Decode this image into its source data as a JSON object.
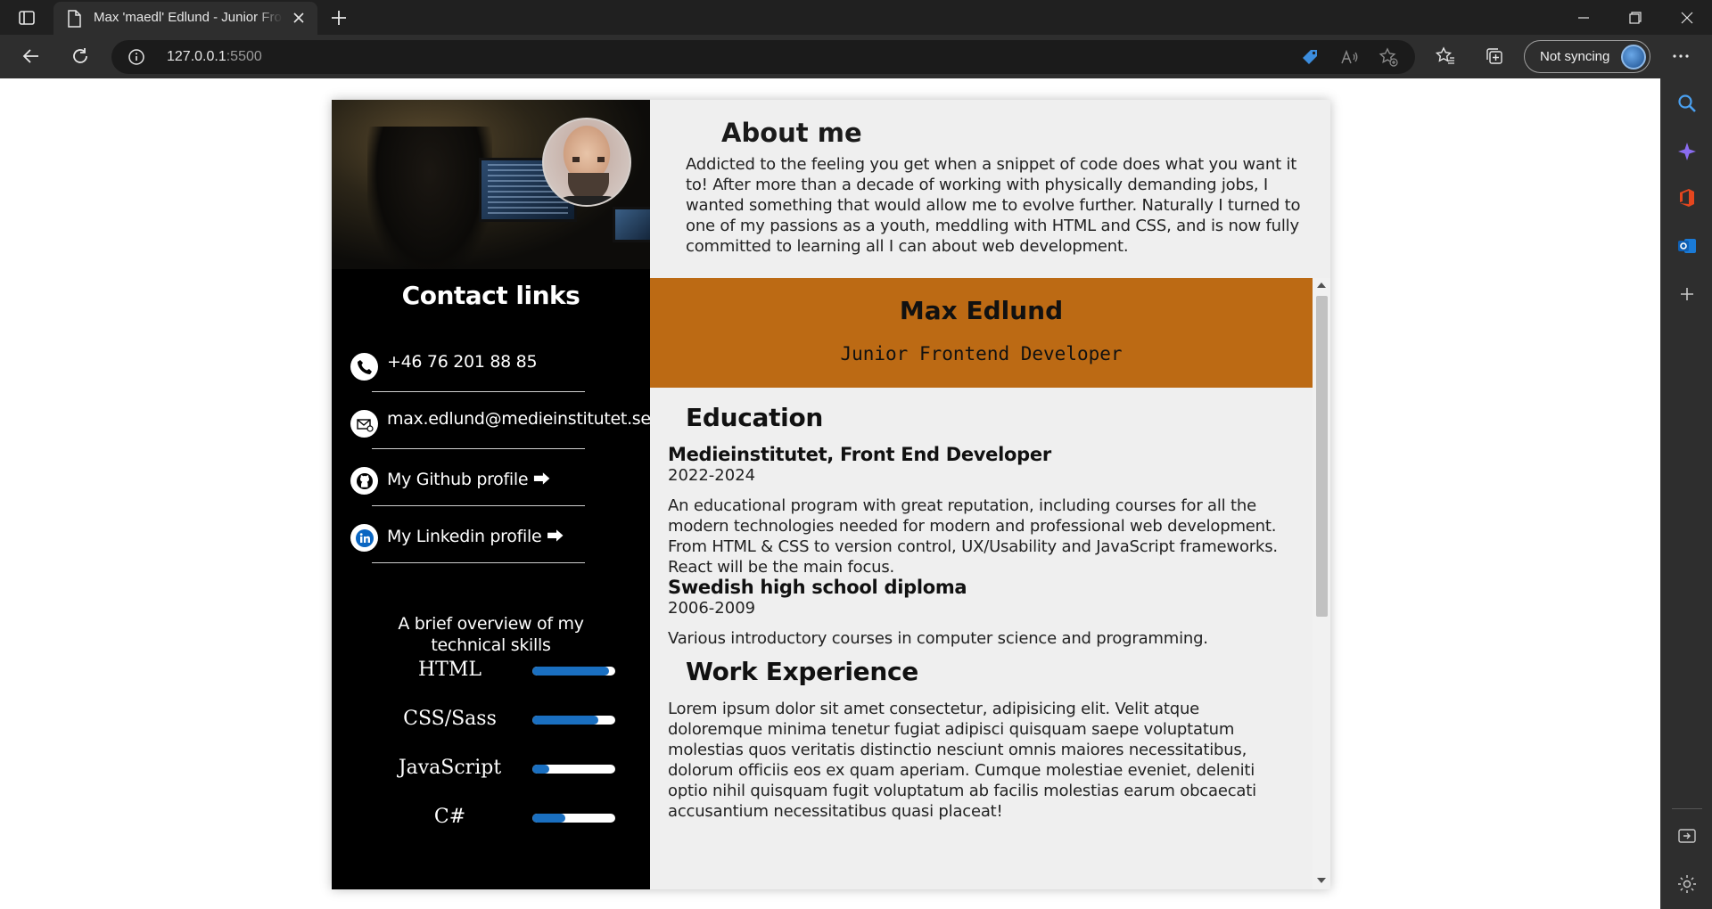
{
  "browser": {
    "tab_title": "Max 'maedl' Edlund - Junior Frontend Developer",
    "url_host": "127.0.0.1",
    "url_port": ":5500",
    "sync_label": "Not syncing"
  },
  "about": {
    "title": "About me",
    "text": "Addicted to the feeling you get when a snippet of code does what you want it to! After more than a decade of working with physically demanding jobs, I wanted something that would allow me to evolve further. Naturally I turned to one of my passions as a youth, meddling with HTML and CSS, and is now fully committed to learning all I can about web development."
  },
  "contact": {
    "title": "Contact links",
    "items": [
      {
        "icon": "phone-icon",
        "label": "+46 76 201 88 85"
      },
      {
        "icon": "mail-icon",
        "label": "max.edlund@medieinstitutet.se"
      },
      {
        "icon": "github-icon",
        "label": "My Github profile ⮕"
      },
      {
        "icon": "linkedin-icon",
        "label": "My Linkedin profile ⮕"
      }
    ]
  },
  "skills": {
    "title": "A brief overview of my technical skills",
    "items": [
      {
        "name": "HTML",
        "level": 0.92
      },
      {
        "name": "CSS/Sass",
        "level": 0.8
      },
      {
        "name": "JavaScript",
        "level": 0.2
      },
      {
        "name": "C#",
        "level": 0.4
      }
    ]
  },
  "header": {
    "name": "Max Edlund",
    "role": "Junior Frontend Developer",
    "accent": "#bc6a14"
  },
  "education": {
    "title": "Education",
    "items": [
      {
        "name": "Medieinstitutet, Front End Developer",
        "years": "2022-2024",
        "text": "An educational program with great reputation, including courses for all the modern technologies needed for modern and professional web development. From HTML & CSS to version control, UX/Usability and JavaScript frameworks. React will be the main focus."
      },
      {
        "name": "Swedish high school diploma",
        "years": "2006-2009",
        "text": "Various introductory courses in computer science and programming."
      }
    ]
  },
  "work": {
    "title": "Work Experience",
    "text": "Lorem ipsum dolor sit amet consectetur, adipisicing elit. Velit atque doloremque minima tenetur fugiat adipisci quisquam saepe voluptatum molestias quos veritatis distinctio nesciunt omnis maiores necessitatibus, dolorum officiis eos ex quam aperiam. Cumque molestiae eveniet, deleniti optio nihil quisquam fugit voluptatum ab facilis molestias earum obcaecati accusantium necessitatibus quasi placeat!"
  }
}
